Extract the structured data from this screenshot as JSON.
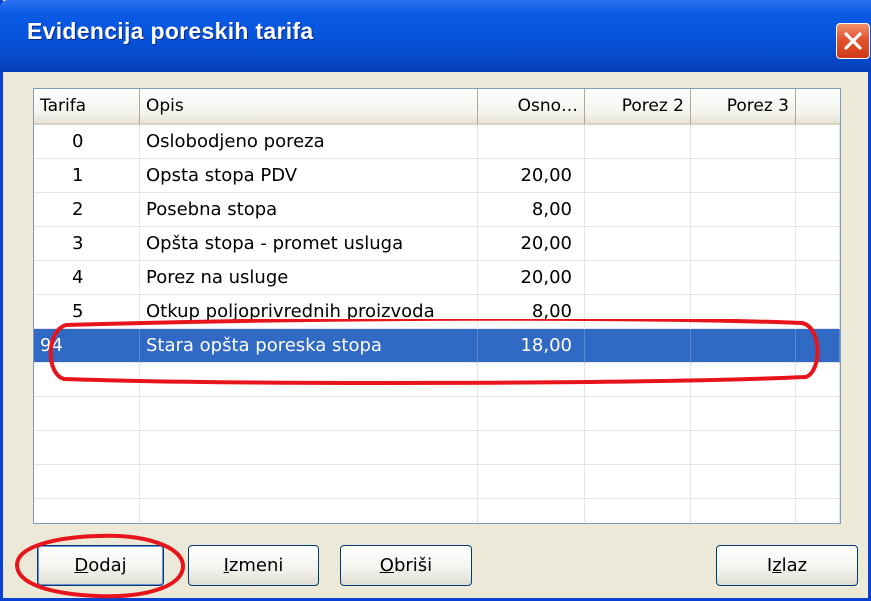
{
  "window": {
    "title": "Evidencija poreskih tarifa",
    "close_icon": "close-icon",
    "accent_color": "#0a5ae4",
    "selection_color": "#316ac5"
  },
  "grid": {
    "columns": [
      {
        "label": "Tarifa"
      },
      {
        "label": "Opis"
      },
      {
        "label": "Osno…"
      },
      {
        "label": "Porez 2"
      },
      {
        "label": "Porez 3"
      },
      {
        "label": ""
      }
    ],
    "rows": [
      {
        "tarifa": "0",
        "opis": "Oslobodjeno poreza",
        "osnovna": "",
        "porez2": "",
        "porez3": ""
      },
      {
        "tarifa": "1",
        "opis": "Opsta stopa PDV",
        "osnovna": "20,00",
        "porez2": "",
        "porez3": ""
      },
      {
        "tarifa": "2",
        "opis": "Posebna stopa",
        "osnovna": "8,00",
        "porez2": "",
        "porez3": ""
      },
      {
        "tarifa": "3",
        "opis": "Opšta stopa - promet usluga",
        "osnovna": "20,00",
        "porez2": "",
        "porez3": ""
      },
      {
        "tarifa": "4",
        "opis": "Porez na usluge",
        "osnovna": "20,00",
        "porez2": "",
        "porez3": ""
      },
      {
        "tarifa": "5",
        "opis": "Otkup poljoprivrednih proizvoda",
        "osnovna": "8,00",
        "porez2": "",
        "porez3": ""
      },
      {
        "tarifa": "94",
        "opis": "Stara opšta poreska stopa",
        "osnovna": "18,00",
        "porez2": "",
        "porez3": "",
        "selected": true
      }
    ],
    "empty_rows": 5
  },
  "buttons": {
    "add": {
      "key": "D",
      "rest": "odaj"
    },
    "edit": {
      "key": "I",
      "rest": "zmeni"
    },
    "delete": {
      "key": "O",
      "rest": "briši"
    },
    "exit": {
      "pre": "I",
      "key": "z",
      "rest": "laz"
    }
  },
  "annotation_color": "#e8141b"
}
